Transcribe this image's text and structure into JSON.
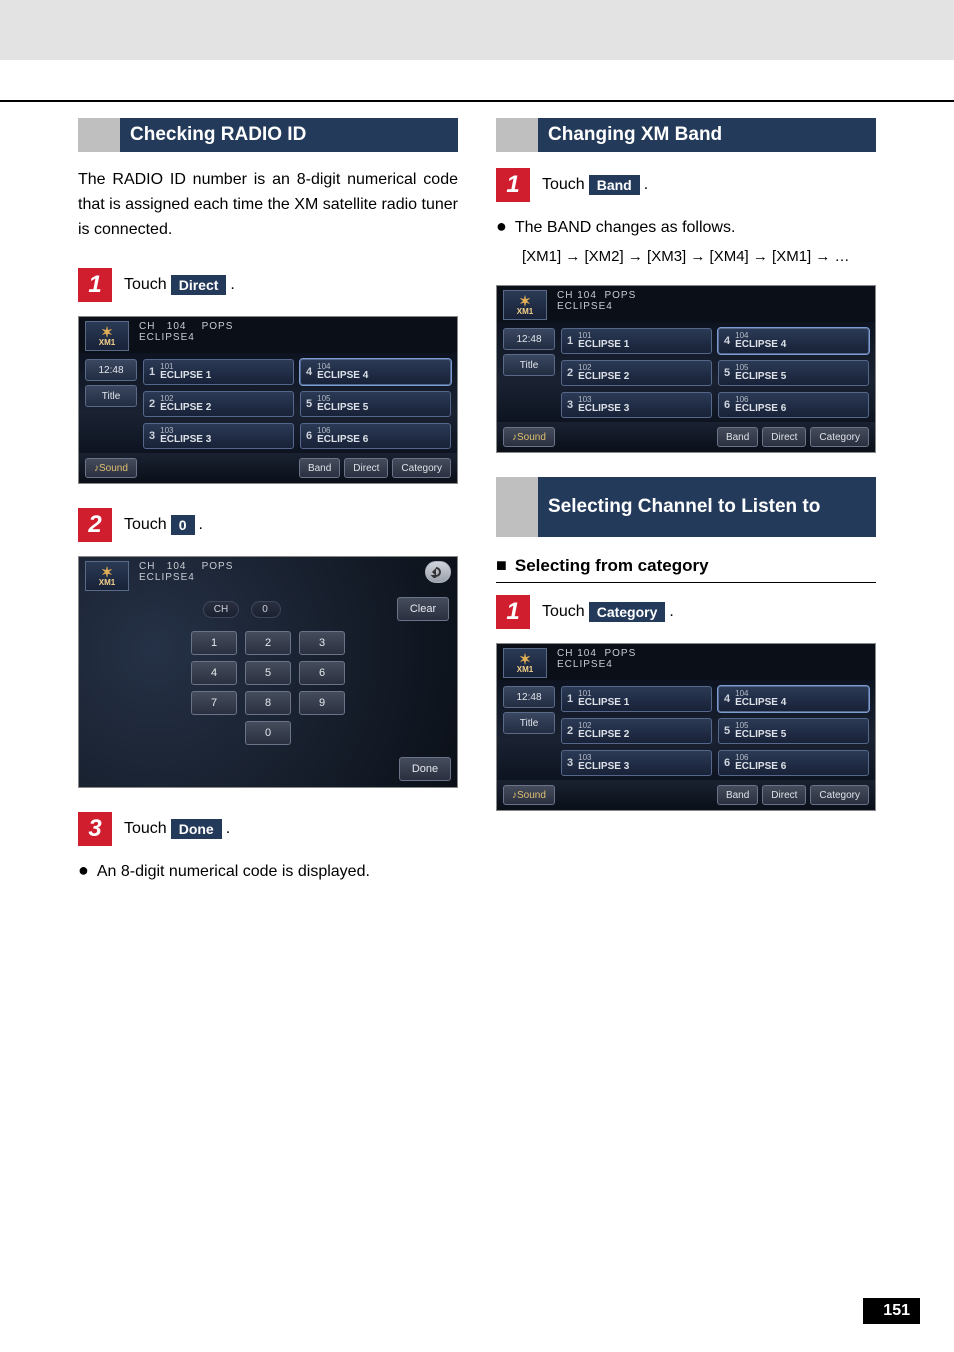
{
  "page_number": "151",
  "left": {
    "section_title": "Checking RADIO ID",
    "intro": "The RADIO ID number is an 8-digit numerical code that is assigned each time the XM satellite radio tuner is connected.",
    "step1": {
      "prefix": "Touch ",
      "label": "Direct",
      "suffix": " ."
    },
    "step2": {
      "prefix": "Touch ",
      "label": "   0   ",
      "suffix": " ."
    },
    "step3": {
      "prefix": "Touch ",
      "label": "Done",
      "suffix": " ."
    },
    "result_bullet": "An 8-digit numerical code is displayed."
  },
  "right": {
    "section_title_band": "Changing XM Band",
    "step1_band": {
      "prefix": "Touch ",
      "label": "Band",
      "suffix": " ."
    },
    "band_bullet": "The BAND changes as follows.",
    "band_flow": "[XM1] → [XM2] → [XM3] → [XM4] → [XM1] → …",
    "section_title_select": "Selecting Channel to Listen to",
    "subhead": "Selecting from category",
    "step1_cat": {
      "prefix": "Touch ",
      "label": "Category",
      "suffix": " ."
    }
  },
  "shot_common": {
    "xm_label": "XM1",
    "ch_label": "CH",
    "ch_num": "104",
    "category": "POPS",
    "title_sub": "ECLIPSE4",
    "left_time": "12:48",
    "left_title": "Title",
    "sound": "Sound",
    "band": "Band",
    "direct": "Direct",
    "category_btn": "Category",
    "presets": [
      {
        "n": "1",
        "ch": "101",
        "name": "ECLIPSE 1"
      },
      {
        "n": "4",
        "ch": "104",
        "name": "ECLIPSE 4"
      },
      {
        "n": "2",
        "ch": "102",
        "name": "ECLIPSE 2"
      },
      {
        "n": "5",
        "ch": "105",
        "name": "ECLIPSE 5"
      },
      {
        "n": "3",
        "ch": "103",
        "name": "ECLIPSE 3"
      },
      {
        "n": "6",
        "ch": "106",
        "name": "ECLIPSE 6"
      }
    ]
  },
  "keypad": {
    "ch": "CH",
    "chval": "0",
    "clear": "Clear",
    "done": "Done",
    "rows": [
      [
        "1",
        "2",
        "3"
      ],
      [
        "4",
        "5",
        "6"
      ],
      [
        "7",
        "8",
        "9"
      ],
      [
        "0"
      ]
    ]
  }
}
